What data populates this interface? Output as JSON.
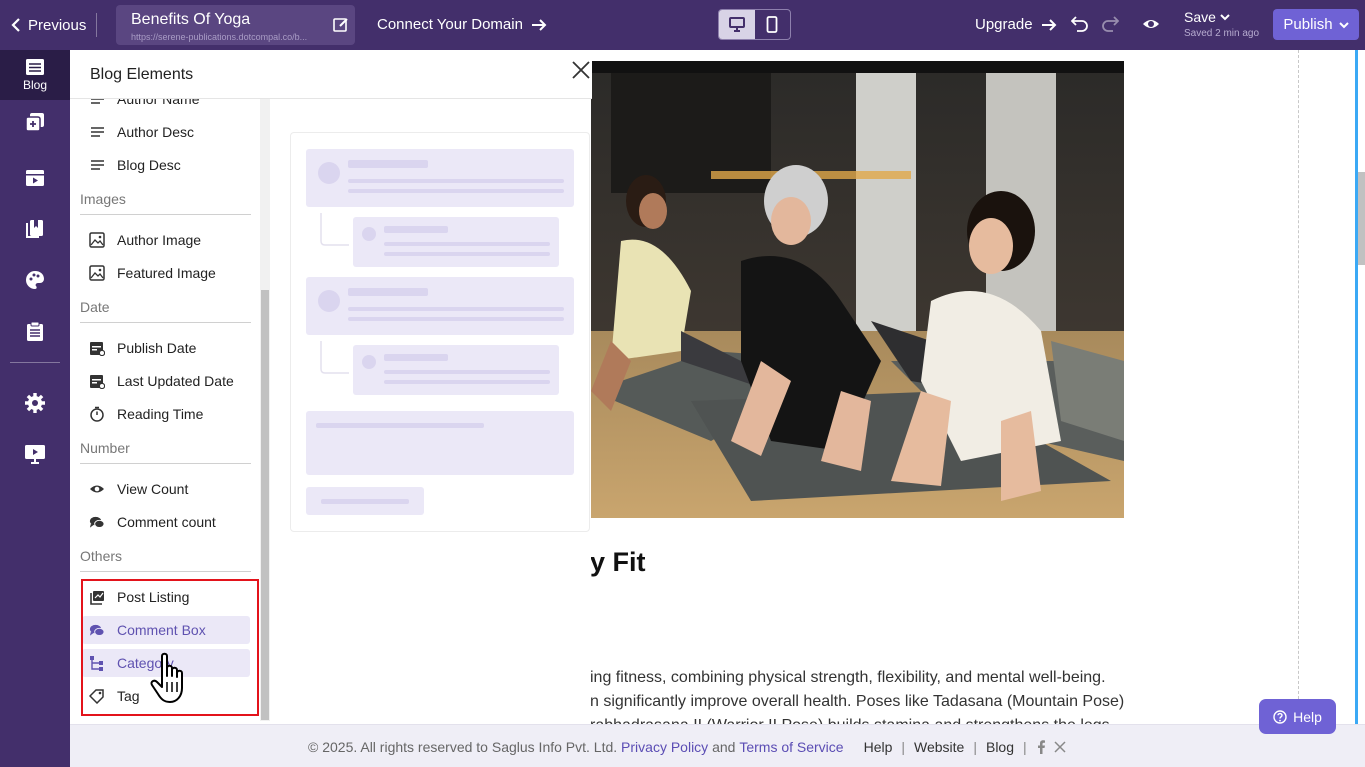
{
  "topbar": {
    "previous_label": "Previous",
    "page_title": "Benefits Of Yoga",
    "page_url": "https://serene-publications.dotcompal.co/b...",
    "connect_domain_label": "Connect Your Domain",
    "upgrade_label": "Upgrade",
    "save_label": "Save",
    "saved_status": "Saved 2 min ago",
    "publish_label": "Publish"
  },
  "rail": {
    "items": [
      {
        "label": "Blog",
        "icon": "blog-icon",
        "active": true
      },
      {
        "icon": "add-pages-icon"
      },
      {
        "icon": "media-icon"
      },
      {
        "icon": "bookmarks-icon"
      },
      {
        "icon": "palette-icon"
      },
      {
        "icon": "clipboard-icon"
      },
      {
        "icon": "gear-icon"
      },
      {
        "icon": "presentation-icon"
      }
    ]
  },
  "panel": {
    "title": "Blog Elements",
    "items": {
      "author_name": "Author Name",
      "author_desc": "Author Desc",
      "blog_desc": "Blog Desc",
      "author_image": "Author Image",
      "featured_image": "Featured Image",
      "publish_date": "Publish Date",
      "last_updated_date": "Last Updated Date",
      "reading_time": "Reading Time",
      "view_count": "View Count",
      "comment_count": "Comment count",
      "post_listing": "Post Listing",
      "comment_box": "Comment Box",
      "category": "Category",
      "tag": "Tag"
    },
    "sections": {
      "images": "Images",
      "date": "Date",
      "number": "Number",
      "others": "Others"
    }
  },
  "canvas": {
    "heading_fragment": "y Fit",
    "body_lines": [
      "ing fitness, combining physical strength, flexibility, and mental well-being.",
      "n significantly improve overall health. Poses like Tadasana (Mountain Pose)",
      "rabhadrasana II (Warrior II Pose) builds stamina and strengthens the legs."
    ]
  },
  "footer": {
    "copyright": "©  2025. All rights reserved to Saglus Info Pvt. Ltd.",
    "privacy": "Privacy Policy",
    "and": "and",
    "terms": "Terms of Service",
    "help": "Help",
    "website": "Website",
    "blog": "Blog",
    "sep": "|"
  },
  "help_button": "Help",
  "colors": {
    "topbar": "#432f6b",
    "accent": "#6f62d5",
    "highlight": "#ebe8f7",
    "red_outline": "#e3131b"
  }
}
